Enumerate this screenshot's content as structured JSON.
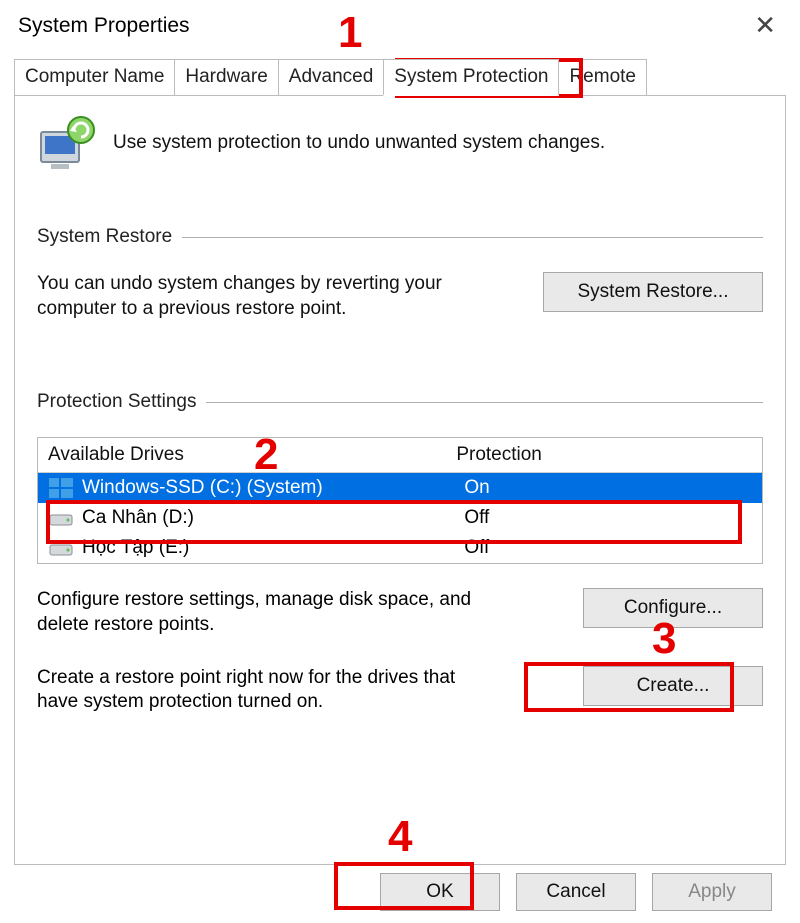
{
  "window": {
    "title": "System Properties"
  },
  "tabs": {
    "items": [
      {
        "label": "Computer Name"
      },
      {
        "label": "Hardware"
      },
      {
        "label": "Advanced"
      },
      {
        "label": "System Protection"
      },
      {
        "label": "Remote"
      }
    ],
    "active_index": 3
  },
  "intro": {
    "text": "Use system protection to undo unwanted system changes."
  },
  "groups": {
    "restore": {
      "title": "System Restore"
    },
    "protection": {
      "title": "Protection Settings"
    }
  },
  "restore": {
    "text": "You can undo system changes by reverting your computer to a previous restore point.",
    "button": "System Restore..."
  },
  "drives": {
    "col_drive": "Available Drives",
    "col_prot": "Protection",
    "rows": [
      {
        "label": "Windows-SSD (C:) (System)",
        "protection": "On",
        "selected": true,
        "system": true
      },
      {
        "label": "Ca Nhân (D:)",
        "protection": "Off",
        "selected": false,
        "system": false
      },
      {
        "label": "Học Tập (E:)",
        "protection": "Off",
        "selected": false,
        "system": false
      }
    ]
  },
  "configure": {
    "text": "Configure restore settings, manage disk space, and delete restore points.",
    "button": "Configure..."
  },
  "create": {
    "text": "Create a restore point right now for the drives that have system protection turned on.",
    "button": "Create..."
  },
  "footer": {
    "ok": "OK",
    "cancel": "Cancel",
    "apply": "Apply"
  },
  "markers": {
    "m1": "1",
    "m2": "2",
    "m3": "3",
    "m4": "4"
  }
}
